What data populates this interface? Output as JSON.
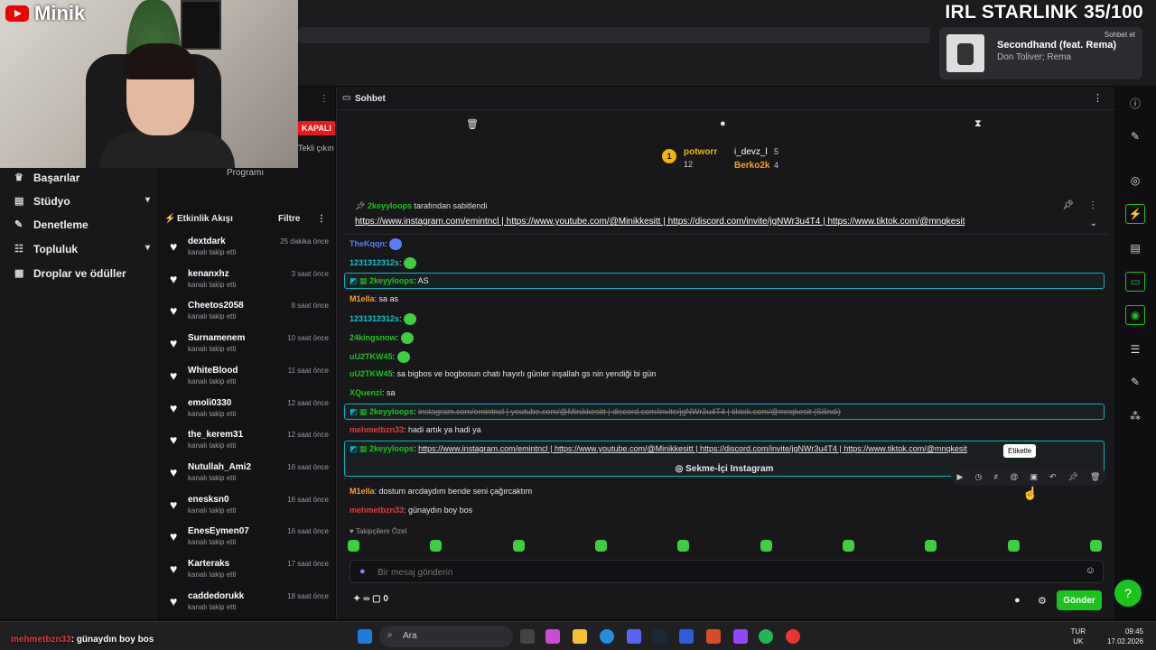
{
  "overlay": {
    "brand": "Minik",
    "title": "IRL STARLINK 35/100"
  },
  "now_playing": {
    "title": "Secondhand (feat. Rema)",
    "artist": "Don Toliver; Rema",
    "sohbet_label": "Sohbet et"
  },
  "left_nav": {
    "items": [
      {
        "label": "Başarılar",
        "icon": "trophy-icon",
        "chevron": false
      },
      {
        "label": "Stüdyo",
        "icon": "studio-icon",
        "chevron": true
      },
      {
        "label": "Denetleme",
        "icon": "wrench-icon",
        "chevron": false
      },
      {
        "label": "Topluluk",
        "icon": "community-icon",
        "chevron": true
      },
      {
        "label": "Droplar ve ödüller",
        "icon": "gift-icon",
        "chevron": false
      }
    ]
  },
  "activity": {
    "kapali": "KAPALI",
    "tekli": "Tekli\nçıkın",
    "program": "Programı",
    "title": "Etkinlik Akışı",
    "filter": "Filtre",
    "items": [
      {
        "name": "dextdark",
        "sub": "kanalı takip etti",
        "time": "25 dakika önce"
      },
      {
        "name": "kenanxhz",
        "sub": "kanalı takip etti",
        "time": "3 saat önce"
      },
      {
        "name": "Cheetos2058",
        "sub": "kanalı takip etti",
        "time": "8 saat önce"
      },
      {
        "name": "Surnamenem",
        "sub": "kanalı takip etti",
        "time": "10 saat önce"
      },
      {
        "name": "WhiteBlood",
        "sub": "kanalı takip etti",
        "time": "11 saat önce"
      },
      {
        "name": "emoli0330",
        "sub": "kanalı takip etti",
        "time": "12 saat önce"
      },
      {
        "name": "the_kerem31",
        "sub": "kanalı takip etti",
        "time": "12 saat önce"
      },
      {
        "name": "Nutullah_Ami2",
        "sub": "kanalı takip etti",
        "time": "16 saat önce"
      },
      {
        "name": "enesksn0",
        "sub": "kanalı takip etti",
        "time": "16 saat önce"
      },
      {
        "name": "EnesEymen07",
        "sub": "kanalı takip etti",
        "time": "16 saat önce"
      },
      {
        "name": "Karteraks",
        "sub": "kanalı takip etti",
        "time": "17 saat önce"
      },
      {
        "name": "caddedorukk",
        "sub": "kanalı takip etti",
        "time": "18 saat önce"
      }
    ]
  },
  "chat": {
    "title": "Sohbet",
    "leaderboard": {
      "first": {
        "rank": "1",
        "name": "potworr",
        "count": "12"
      },
      "second": {
        "name": "i_devz_l",
        "count": "5"
      },
      "third": {
        "name": "Berko2k",
        "count": "4"
      }
    },
    "pinned": {
      "by_user": "2keyyloops",
      "by_text": "tarafından sabitlendi",
      "text": "https://www.instagram.com/emintncl | https://www.youtube.com/@Minikkesitt | https://discord.com/invite/jgNWr3u4T4 | https://www.tiktok.com/@mnqkesit"
    },
    "messages": [
      {
        "user": "TheKqqn",
        "text": "",
        "color": "#5b7bff",
        "emote": true
      },
      {
        "user": "1231312312s",
        "text": "",
        "color": "#00c8d0",
        "emote": true
      },
      {
        "user": "2keyyloops",
        "text": "AS",
        "color": "#1bc41b",
        "emote": false
      },
      {
        "user": "M1ella",
        "text": "sa as",
        "color": "#ff9f1a",
        "emote": false
      },
      {
        "user": "1231312312s",
        "text": "",
        "color": "#00c8d0",
        "emote": true
      },
      {
        "user": "24kingsnow",
        "text": "",
        "color": "#1bc41b",
        "emote": true
      },
      {
        "user": "uU2TKW45",
        "text": "",
        "color": "#1bc41b",
        "emote": true
      },
      {
        "user": "uU2TKW45",
        "text": "sa bigbos ve bogbosun chatı hayırlı günler inşallah gs nin yendiği bi gün",
        "color": "#1bc41b",
        "emote": false
      },
      {
        "user": "XQuenzi",
        "text": "sa",
        "color": "#1bc41b",
        "emote": false
      },
      {
        "user": "2keyyloops",
        "text": "instagram.com/emintncl | youtube.com/@Minikkesitt | discord.com/invite/jgNWr3u4T4 | tiktok.com/@mnqkesit (Silindi)",
        "color": "#1bc41b",
        "emote": false
      },
      {
        "user": "mehmetbzn33",
        "text": "hadi artık ya hadi ya",
        "color": "#e23b3b",
        "emote": false
      },
      {
        "user": "2keyyloops",
        "text": "https://www.instagram.com/emintncl | https://www.youtube.com/@Minikkesitt | https://discord.com/invite/jgNWr3u4T4 | https://www.tiktok.com/@mnqkesit",
        "color": "#1bc41b",
        "emote": false
      },
      {
        "user": "M1ella",
        "text": "dostum arcdaydım bende seni çağırcaktım",
        "color": "#ff9f1a",
        "emote": false
      },
      {
        "user": "mehmetbzn33",
        "text": "günaydın boy bos",
        "color": "#e23b3b",
        "emote": false
      }
    ],
    "instagram_tab": "Sekme-İçi Instagram",
    "tooltip": "Etiketle",
    "followers_only": "Takipçilere Özel",
    "input_placeholder": "Bir mesaj gönderin",
    "points": "0",
    "send_label": "Gönder"
  },
  "ticker": {
    "user": "mehmetbzn33",
    "text": ": günaydın boy bos"
  },
  "taskbar": {
    "search": "Ara",
    "lang_top": "TUR",
    "lang_bottom": "UK",
    "time": "09:45",
    "date": "17.02.2026"
  },
  "colors": {
    "accent": "#1bc41b",
    "highlight_border": "#00b7c3",
    "kapali_red": "#e91916"
  }
}
